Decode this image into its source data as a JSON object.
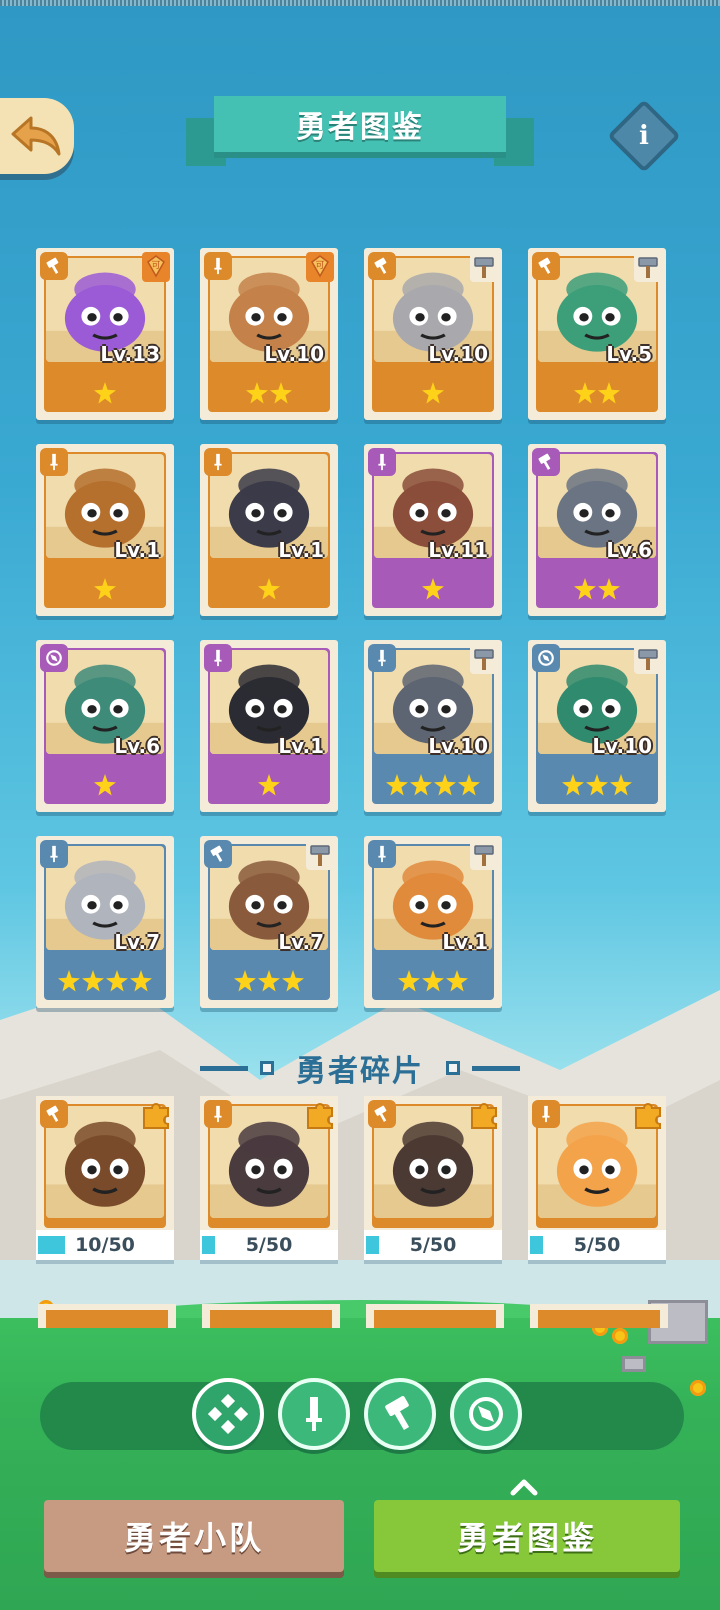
{
  "header": {
    "title": "勇者图鉴",
    "info_label": "i"
  },
  "heroes": [
    {
      "level": "Lv.13",
      "stars": 1,
      "rarity": "orange",
      "role": "hammer",
      "weapon": "gem",
      "color": "#9b5bd6"
    },
    {
      "level": "Lv.10",
      "stars": 2,
      "rarity": "orange",
      "role": "sword",
      "weapon": "gem",
      "color": "#c4824a"
    },
    {
      "level": "Lv.10",
      "stars": 1,
      "rarity": "orange",
      "role": "hammer",
      "weapon": "hammer",
      "color": "#a9a9ad"
    },
    {
      "level": "Lv.5",
      "stars": 2,
      "rarity": "orange",
      "role": "hammer",
      "weapon": "hammer",
      "color": "#3c9f7a"
    },
    {
      "level": "Lv.1",
      "stars": 1,
      "rarity": "orange",
      "role": "sword",
      "weapon": "",
      "color": "#b5702e"
    },
    {
      "level": "Lv.1",
      "stars": 1,
      "rarity": "orange",
      "role": "sword",
      "weapon": "",
      "color": "#3b3b49"
    },
    {
      "level": "Lv.11",
      "stars": 1,
      "rarity": "purple",
      "role": "sword",
      "weapon": "",
      "color": "#8a4e3a"
    },
    {
      "level": "Lv.6",
      "stars": 2,
      "rarity": "purple",
      "role": "hammer",
      "weapon": "",
      "color": "#6a7482"
    },
    {
      "level": "Lv.6",
      "stars": 1,
      "rarity": "purple",
      "role": "compass",
      "weapon": "",
      "color": "#3f8b7a"
    },
    {
      "level": "Lv.1",
      "stars": 1,
      "rarity": "purple",
      "role": "sword",
      "weapon": "",
      "color": "#2b2b33"
    },
    {
      "level": "Lv.10",
      "stars": 4,
      "rarity": "blue",
      "role": "sword",
      "weapon": "hammer",
      "color": "#5d6472"
    },
    {
      "level": "Lv.10",
      "stars": 3,
      "rarity": "blue",
      "role": "compass",
      "weapon": "hammer",
      "color": "#2f8a6e"
    },
    {
      "level": "Lv.7",
      "stars": 4,
      "rarity": "blue",
      "role": "sword",
      "weapon": "",
      "color": "#b0b4bd"
    },
    {
      "level": "Lv.7",
      "stars": 3,
      "rarity": "blue",
      "role": "hammer",
      "weapon": "hammer",
      "color": "#8a5a3c"
    },
    {
      "level": "Lv.1",
      "stars": 3,
      "rarity": "blue",
      "role": "sword",
      "weapon": "hammer",
      "color": "#e08a3c"
    }
  ],
  "fragments_section": {
    "title": "勇者碎片"
  },
  "fragments": [
    {
      "count": "10/50",
      "progress": 0.2,
      "role": "hammer",
      "color": "#7a4b2a"
    },
    {
      "count": "5/50",
      "progress": 0.1,
      "role": "sword",
      "color": "#4a3b3f"
    },
    {
      "count": "5/50",
      "progress": 0.1,
      "role": "hammer",
      "color": "#4b3a33"
    },
    {
      "count": "5/50",
      "progress": 0.1,
      "role": "sword",
      "color": "#f3a34a"
    }
  ],
  "filters": [
    {
      "name": "all",
      "icon": "diamond-grid-icon",
      "active": true
    },
    {
      "name": "sword",
      "icon": "sword-icon",
      "active": false
    },
    {
      "name": "hammer",
      "icon": "hammer-icon",
      "active": false
    },
    {
      "name": "compass",
      "icon": "compass-icon",
      "active": false
    }
  ],
  "bottom_nav": {
    "team_label": "勇者小队",
    "codex_label": "勇者图鉴"
  },
  "colors": {
    "rarity_orange": "#dd8a2b",
    "rarity_purple": "#a85ab8",
    "rarity_blue": "#5a89b0",
    "star": "#ffd21a",
    "title_banner": "#45c1b3"
  }
}
